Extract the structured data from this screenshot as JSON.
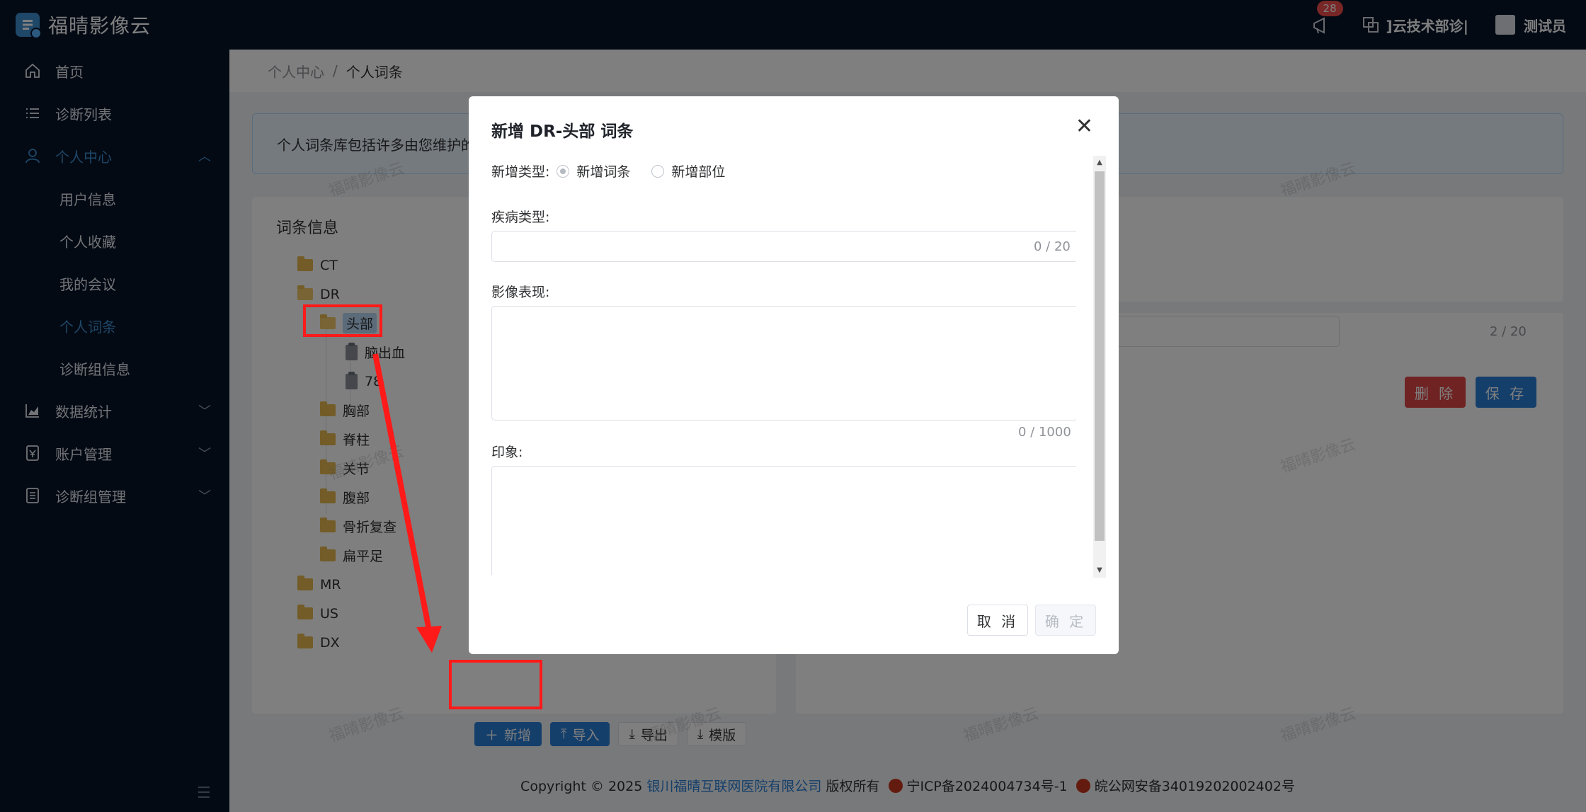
{
  "topbar": {
    "app_name": "福晴影像云",
    "notification_count": "28",
    "org_name": "]云技术部诊|",
    "user_name": "测试员"
  },
  "sidebar": {
    "items": [
      {
        "label": "首页",
        "icon": "home-icon"
      },
      {
        "label": "诊断列表",
        "icon": "list-icon"
      },
      {
        "label": "个人中心",
        "icon": "user-icon"
      },
      {
        "label": "数据统计",
        "icon": "chart-icon"
      },
      {
        "label": "账户管理",
        "icon": "account-icon"
      },
      {
        "label": "诊断组管理",
        "icon": "group-icon"
      }
    ],
    "submenu": [
      {
        "label": "用户信息"
      },
      {
        "label": "个人收藏"
      },
      {
        "label": "我的会议"
      },
      {
        "label": "个人词条"
      },
      {
        "label": "诊断组信息"
      }
    ]
  },
  "breadcrumb": {
    "parent": "个人中心",
    "separator": "/",
    "current": "个人词条"
  },
  "alert": {
    "text": "个人词条库包括许多由您维护的词"
  },
  "tree": {
    "title": "词条信息",
    "nodes": [
      "CT",
      "DR",
      "头部",
      "脑出血",
      "78",
      "胸部",
      "脊柱",
      "关节",
      "腹部",
      "骨折复查",
      "扁平足",
      "MR",
      "US",
      "DX"
    ]
  },
  "actions": {
    "add": "新增",
    "import": "导入",
    "export": "导出",
    "template": "模版"
  },
  "editor": {
    "count": "2 / 20",
    "delete": "删 除",
    "save": "保 存"
  },
  "footer": {
    "copyright": "Copyright © 2025",
    "company": "银川福晴互联网医院有限公司",
    "rights": "版权所有",
    "icp": "宁ICP备2024004734号-1",
    "police": "皖公网安备34019202002402号"
  },
  "watermark": {
    "text": "福晴影像云"
  },
  "modal": {
    "title": "新增 DR-头部 词条",
    "type_label": "新增类型:",
    "type_options": [
      "新增词条",
      "新增部位"
    ],
    "disease_label": "疾病类型:",
    "disease_count": "0 / 20",
    "finding_label": "影像表现:",
    "finding_count": "0 / 1000",
    "impression_label": "印象:",
    "cancel": "取 消",
    "confirm": "确 定"
  }
}
